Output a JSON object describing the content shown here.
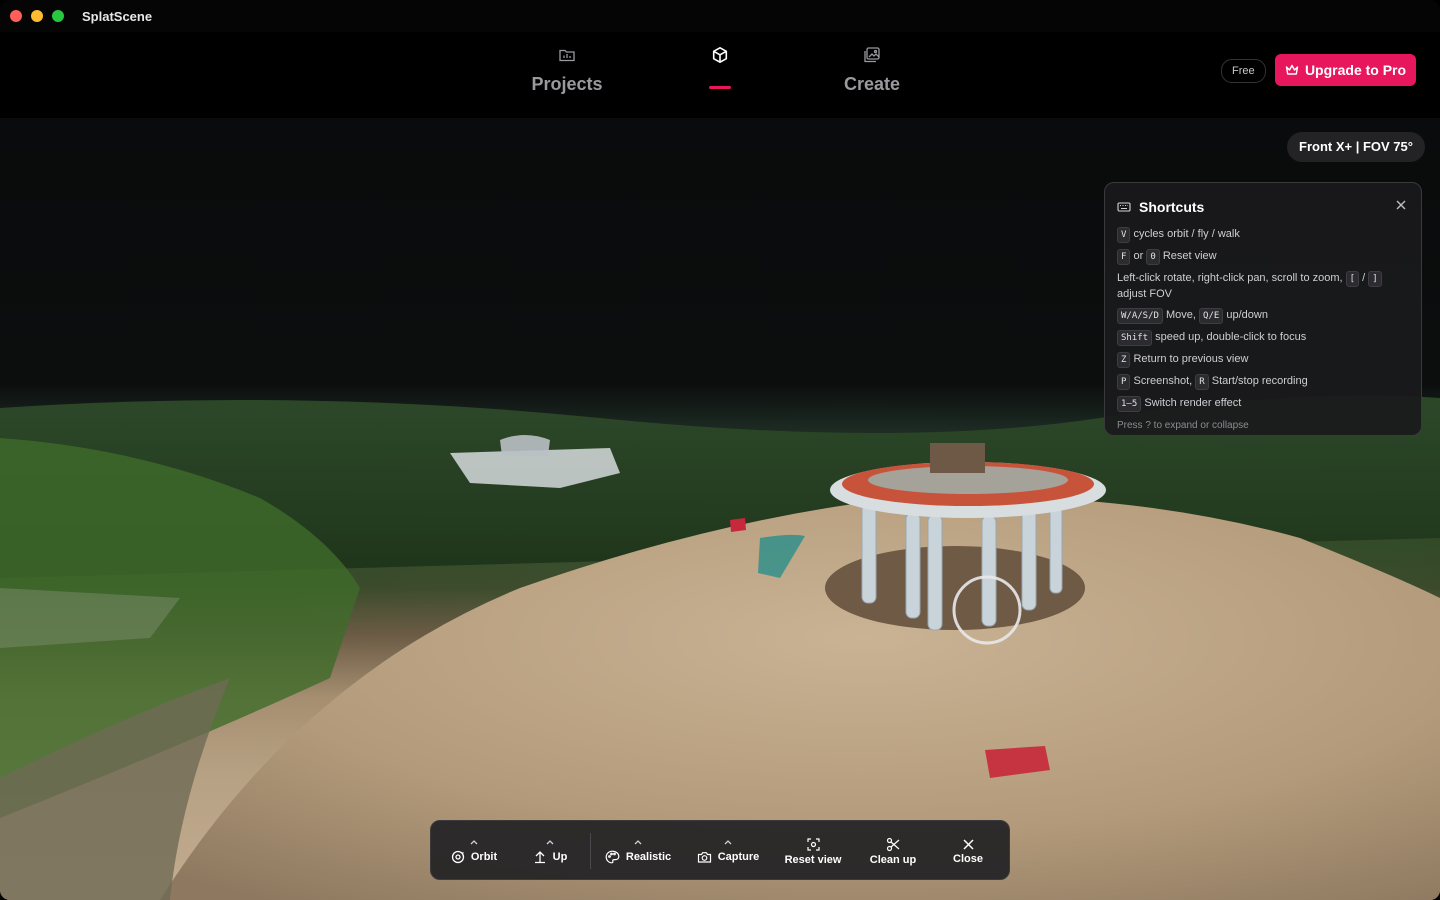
{
  "app": {
    "title": "SplatScene"
  },
  "nav": {
    "tabs": [
      {
        "label": "Projects",
        "icon": "folder-chart-icon"
      },
      {
        "label": "",
        "icon": "cube-icon",
        "active": true
      },
      {
        "label": "Create",
        "icon": "image-plus-icon"
      }
    ],
    "badge": "Free",
    "upgrade_label": "Upgrade to Pro"
  },
  "viewport": {
    "camera_label": "Front X+ | FOV 75°"
  },
  "shortcuts": {
    "title": "Shortcuts",
    "lines": [
      {
        "keys": [
          "V"
        ],
        "text": "cycles orbit / fly / walk"
      },
      {
        "keys": [
          "F",
          "0"
        ],
        "text": "Reset view",
        "joiner": "or"
      },
      {
        "keys": [
          "[",
          "]"
        ],
        "pre": "Left-click rotate, right-click pan, scroll to zoom,",
        "post": "adjust FOV"
      },
      {
        "keys": [
          "W/A/S/D",
          "Q/E"
        ],
        "text1": "Move,",
        "text2": "up/down"
      },
      {
        "keys": [
          "Shift"
        ],
        "text": "speed up, double-click to focus"
      },
      {
        "keys": [
          "Z"
        ],
        "text": "Return to previous view"
      },
      {
        "keys": [
          "P",
          "R"
        ],
        "text1": "Screenshot,",
        "text2": "Start/stop recording"
      },
      {
        "keys": [
          "1–5"
        ],
        "text": "Switch render effect"
      }
    ],
    "footer": "Press ? to expand or collapse"
  },
  "toolbar": {
    "orbit": "Orbit",
    "up": "Up",
    "realistic": "Realistic",
    "capture": "Capture",
    "reset_view": "Reset view",
    "clean_up": "Clean up",
    "close": "Close"
  },
  "colors": {
    "accent": "#e8175d"
  }
}
